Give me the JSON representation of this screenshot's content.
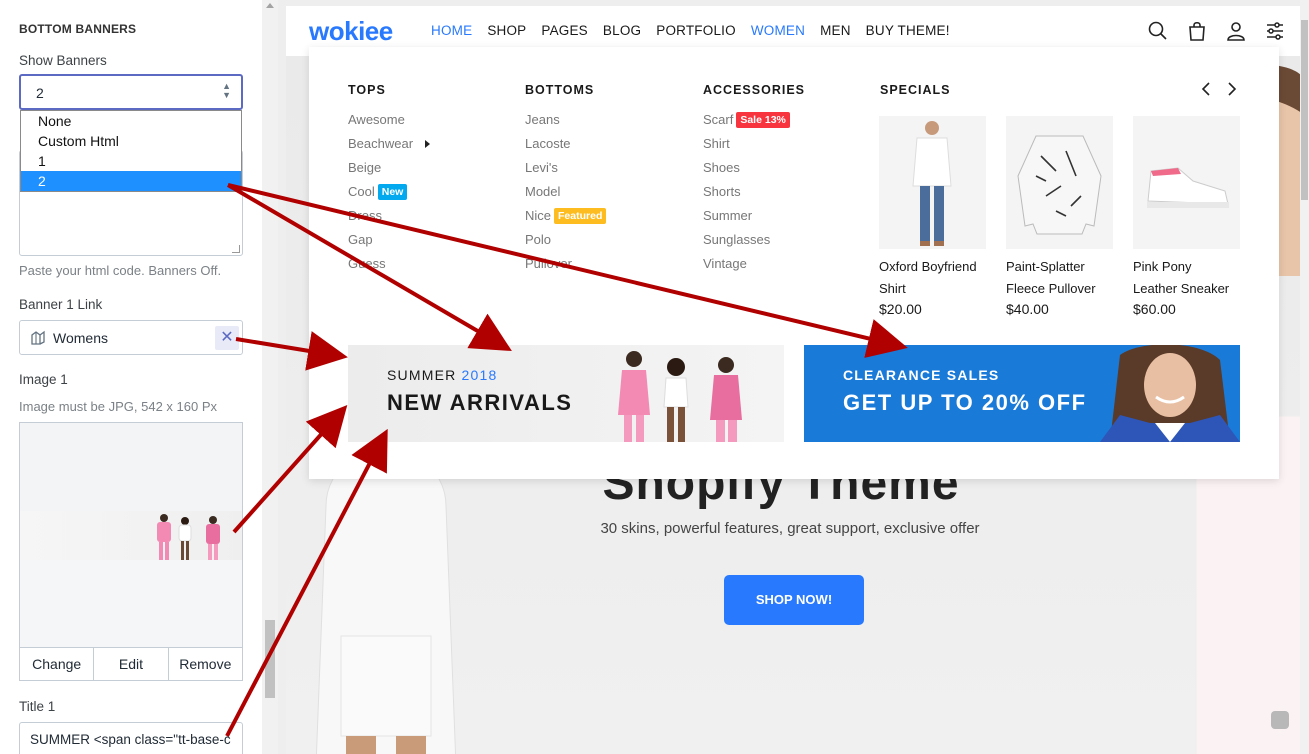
{
  "settings_panel": {
    "section_title": "BOTTOM BANNERS",
    "show_banners_label": "Show Banners",
    "show_banners_value": "2",
    "show_banners_options": [
      "None",
      "Custom Html",
      "1",
      "2"
    ],
    "custom_html_help": "Paste your html code. Banners Off.",
    "banner1_link_label": "Banner 1 Link",
    "banner1_link_value": "Womens",
    "image1_label": "Image 1",
    "image1_help": "Image must be JPG, 542 x 160 Px",
    "image_buttons": [
      "Change",
      "Edit",
      "Remove"
    ],
    "title1_label": "Title 1",
    "title1_value": "SUMMER <span class=\"tt-base-c"
  },
  "store": {
    "logo": "wokiee",
    "nav": [
      {
        "label": "HOME",
        "active": true
      },
      {
        "label": "SHOP",
        "active": false
      },
      {
        "label": "PAGES",
        "active": false
      },
      {
        "label": "BLOG",
        "active": false
      },
      {
        "label": "PORTFOLIO",
        "active": false
      },
      {
        "label": "WOMEN",
        "active": true
      },
      {
        "label": "MEN",
        "active": false
      },
      {
        "label": "BUY THEME!",
        "active": false
      }
    ],
    "header_icons": [
      "search-icon",
      "bag-icon",
      "user-icon",
      "settings-sliders-icon"
    ],
    "accent_color": "#2879fe"
  },
  "megamenu": {
    "tops": {
      "title": "TOPS",
      "items": [
        "Awesome",
        "Beachwear",
        "Beige",
        "Cool",
        "Dress",
        "Gap",
        "Guess"
      ],
      "badges": {
        "Cool": "New"
      }
    },
    "bottoms": {
      "title": "BOTTOMS",
      "items": [
        "Jeans",
        "Lacoste",
        "Levi's",
        "Model",
        "Nice",
        "Polo",
        "Pullover"
      ],
      "badges": {
        "Nice": "Featured"
      }
    },
    "accessories": {
      "title": "ACCESSORIES",
      "items": [
        "Scarf",
        "Shirt",
        "Shoes",
        "Shorts",
        "Summer",
        "Sunglasses",
        "Vintage"
      ],
      "badges": {
        "Scarf": "Sale 13%"
      }
    },
    "specials": {
      "title": "SPECIALS",
      "products": [
        {
          "name_line1": "Oxford Boyfriend",
          "name_line2": "Shirt",
          "price": "$20.00"
        },
        {
          "name_line1": "Paint-Splatter",
          "name_line2": "Fleece Pullover",
          "price": "$40.00"
        },
        {
          "name_line1": "Pink Pony",
          "name_line2": "Leather Sneaker",
          "price": "$60.00"
        }
      ]
    },
    "banner1": {
      "line1_prefix": "SUMMER",
      "line1_year": "2018",
      "line2": "NEW ARRIVALS"
    },
    "banner2": {
      "line1": "CLEARANCE SALES",
      "line2": "GET UP TO 20% OFF"
    }
  },
  "hero": {
    "title": "Shopify Theme",
    "subtitle": "30 skins, powerful features, great support, exclusive offer",
    "button": "SHOP NOW!"
  },
  "annotation_color": "#b00000"
}
